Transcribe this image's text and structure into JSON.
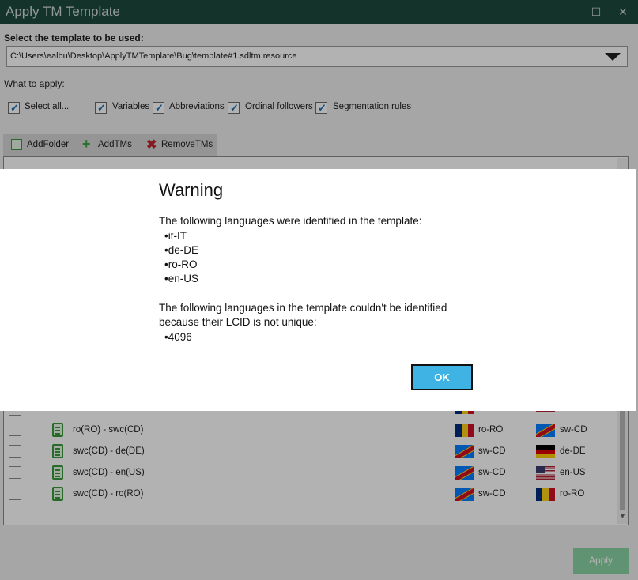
{
  "window": {
    "title": "Apply TM Template",
    "minimize_glyph": "—",
    "maximize_glyph": "☐",
    "close_glyph": "✕"
  },
  "template": {
    "select_label": "Select the template to be used:",
    "path_value": "C:\\Users\\ealbu\\Desktop\\ApplyTMTemplate\\Bug\\template#1.sdltm.resource"
  },
  "apply_options": {
    "label": "What to apply:",
    "items": [
      {
        "label": "Select all...",
        "checked": true
      },
      {
        "label": "Variables",
        "checked": true
      },
      {
        "label": "Abbreviations",
        "checked": true
      },
      {
        "label": "Ordinal followers",
        "checked": true
      },
      {
        "label": "Segmentation rules",
        "checked": true
      }
    ]
  },
  "toolbar": {
    "add_folder": "AddFolder",
    "add_tms": "AddTMs",
    "remove_tms": "RemoveTMs"
  },
  "grid": {
    "rows": [
      {
        "name": "ro(RO) - swc(CD)",
        "source_flag": "flag-romania",
        "source": "ro-RO",
        "target_flag": "flag-dr-congo",
        "target": "sw-CD"
      },
      {
        "name": "swc(CD) - de(DE)",
        "source_flag": "flag-dr-congo",
        "source": "sw-CD",
        "target_flag": "flag-germany",
        "target": "de-DE"
      },
      {
        "name": "swc(CD) - en(US)",
        "source_flag": "flag-dr-congo",
        "source": "sw-CD",
        "target_flag": "flag-usa",
        "target": "en-US"
      },
      {
        "name": "swc(CD) - ro(RO)",
        "source_flag": "flag-dr-congo",
        "source": "sw-CD",
        "target_flag": "flag-romania",
        "target": "ro-RO"
      }
    ]
  },
  "apply_button": "Apply",
  "dialog": {
    "heading": "Warning",
    "identified_intro": "The following languages were identified in the template:",
    "identified": [
      "•it-IT",
      "•de-DE",
      "•ro-RO",
      "•en-US"
    ],
    "unidentified_intro_line1": "The following languages in the template couldn't be identified",
    "unidentified_intro_line2": "because their LCID is not unique:",
    "unidentified": [
      "•4096"
    ],
    "ok_label": "OK"
  },
  "colors": {
    "titlebar": "#1d4a3e",
    "ok_button": "#3fb4e4",
    "apply_button": "#8ad3a2",
    "checkbox_tick": "#1d6fb5"
  }
}
